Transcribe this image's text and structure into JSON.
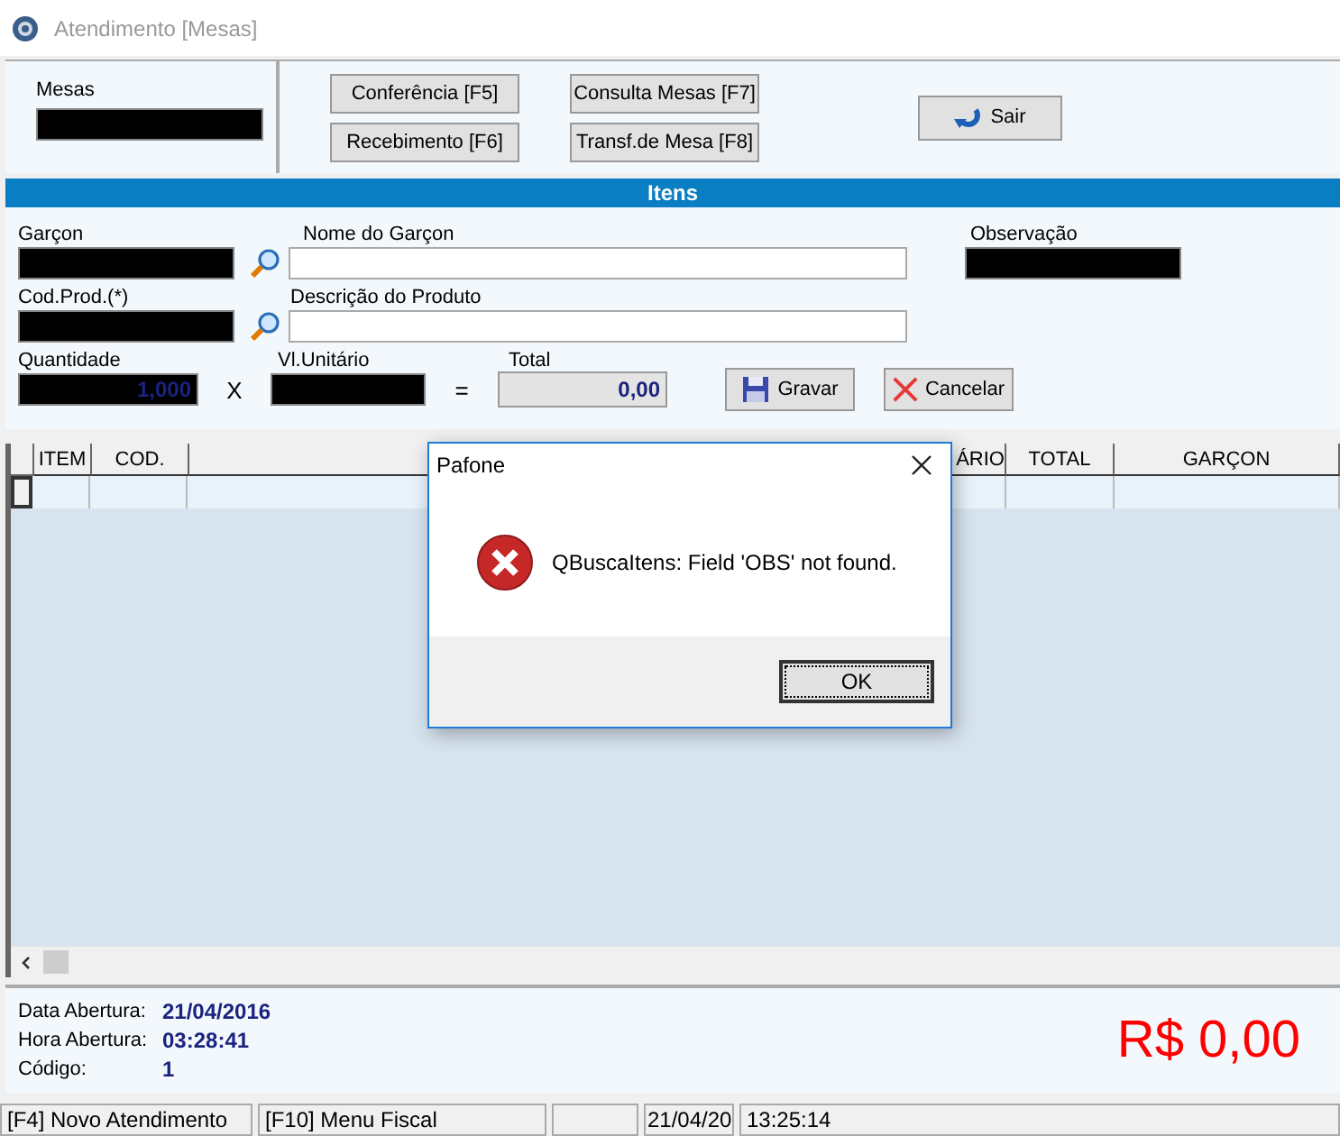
{
  "window": {
    "title": "Atendimento [Mesas]"
  },
  "top": {
    "mesas_label": "Mesas",
    "buttons": [
      {
        "label": "Conferência [F5]"
      },
      {
        "label": "Recebimento [F6]"
      },
      {
        "label": "Consulta Mesas [F7]"
      },
      {
        "label": "Transf.de Mesa [F8]"
      }
    ],
    "exit_button": "Sair"
  },
  "itens": {
    "title": "Itens",
    "garcon_label": "Garçon",
    "nome_label": "Nome do Garçon",
    "obs_label": "Observação",
    "cod_label": "Cod.Prod.(*)",
    "desc_label": "Descrição do Produto",
    "qtd_label": "Quantidade",
    "qtd_value": "1,000",
    "times": "X",
    "unit_label": "Vl.Unitário",
    "equals": "=",
    "total_label": "Total",
    "total_value": "0,00",
    "save_button": "Gravar",
    "cancel_button": "Cancelar"
  },
  "table": {
    "columns": [
      "ITEM",
      "COD.",
      "",
      "ÁRIO",
      "TOTAL",
      "GARÇON"
    ]
  },
  "info": {
    "fields": [
      {
        "label": "Data Abertura:",
        "value": "21/04/2016"
      },
      {
        "label": "Hora Abertura:",
        "value": "03:28:41"
      },
      {
        "label": "Código:",
        "value": "1"
      }
    ],
    "amount": "R$ 0,00"
  },
  "status_bar": [
    "[F4] Novo Atendimento",
    "[F10] Menu Fiscal",
    "21/04/20",
    "13:25:14"
  ],
  "dialog": {
    "title": "Pafone",
    "message": "QBuscaItens: Field 'OBS' not found.",
    "ok": "OK"
  }
}
